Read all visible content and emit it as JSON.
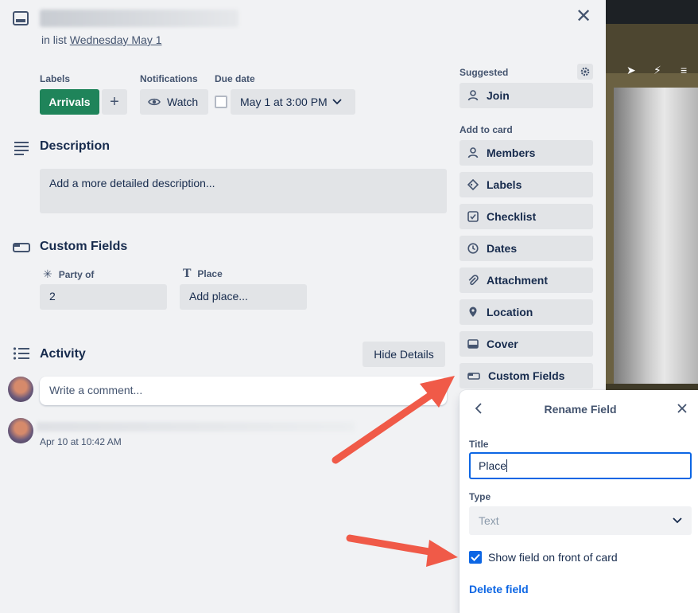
{
  "card": {
    "in_list_prefix": "in list",
    "list_name": "Wednesday May 1"
  },
  "labels": {
    "heading": "Labels",
    "chip": "Arrivals",
    "chip_color": "#1f845a",
    "add_label": "+"
  },
  "notifications": {
    "heading": "Notifications",
    "watch_label": "Watch"
  },
  "due_date": {
    "heading": "Due date",
    "value": "May 1 at 3:00 PM"
  },
  "description": {
    "heading": "Description",
    "placeholder": "Add a more detailed description..."
  },
  "custom_fields": {
    "heading": "Custom Fields",
    "fields": [
      {
        "label": "Party of",
        "value": "2"
      },
      {
        "label": "Place",
        "value": "Add place..."
      }
    ]
  },
  "activity": {
    "heading": "Activity",
    "hide_details": "Hide Details",
    "comment_placeholder": "Write a comment...",
    "entry_time": "Apr 10 at 10:42 AM"
  },
  "sidebar": {
    "suggested_heading": "Suggested",
    "join": "Join",
    "add_to_card_heading": "Add to card",
    "items": [
      {
        "label": "Members",
        "icon": "person-icon"
      },
      {
        "label": "Labels",
        "icon": "tag-icon"
      },
      {
        "label": "Checklist",
        "icon": "checklist-icon"
      },
      {
        "label": "Dates",
        "icon": "clock-icon"
      },
      {
        "label": "Attachment",
        "icon": "paperclip-icon"
      },
      {
        "label": "Location",
        "icon": "location-pin-icon"
      },
      {
        "label": "Cover",
        "icon": "cover-icon"
      },
      {
        "label": "Custom Fields",
        "icon": "custom-fields-icon"
      }
    ]
  },
  "popover": {
    "title": "Rename Field",
    "title_label": "Title",
    "title_value": "Place",
    "type_label": "Type",
    "type_value": "Text",
    "show_on_front_label": "Show field on front of card",
    "show_on_front_checked": true,
    "delete_label": "Delete field"
  },
  "colors": {
    "accent_blue": "#0c66e4",
    "annotation_arrow": "#f05a48"
  }
}
